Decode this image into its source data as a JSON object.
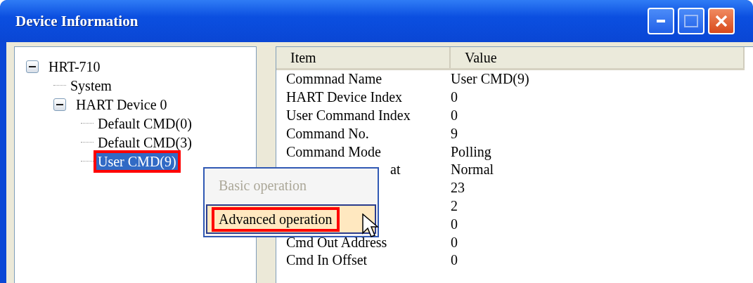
{
  "window": {
    "title": "Device Information"
  },
  "tree": [
    {
      "label": "HRT-710",
      "expanded": true,
      "selected": false,
      "annotated": false,
      "children": [
        {
          "label": "System",
          "selected": false,
          "annotated": false
        },
        {
          "label": "HART Device 0",
          "expanded": true,
          "selected": false,
          "annotated": false,
          "children": [
            {
              "label": "Default CMD(0)",
              "selected": false,
              "annotated": false
            },
            {
              "label": "Default CMD(3)",
              "selected": false,
              "annotated": false
            },
            {
              "label": "User CMD(9)",
              "selected": true,
              "annotated": true
            }
          ]
        }
      ]
    }
  ],
  "list": {
    "columns": [
      "Item",
      "Value"
    ],
    "rows": [
      {
        "item": "Commnad Name",
        "value": "User CMD(9)"
      },
      {
        "item": "HART Device Index",
        "value": "0"
      },
      {
        "item": "User Command Index",
        "value": "0"
      },
      {
        "item": "Command No.",
        "value": "9"
      },
      {
        "item": "Command Mode",
        "value": "Polling"
      },
      {
        "item": "at",
        "partial": true,
        "value": "Normal"
      },
      {
        "value": "23"
      },
      {
        "value": "2"
      },
      {
        "value": "0"
      },
      {
        "item": "Cmd Out Address",
        "value": "0"
      },
      {
        "item": "Cmd In Offset",
        "value": "0"
      }
    ]
  },
  "context_menu": {
    "items": [
      {
        "label": "Basic operation",
        "disabled": true,
        "hovered": false,
        "annotated": false
      },
      {
        "label": "Advanced operation",
        "disabled": false,
        "hovered": true,
        "annotated": true
      }
    ]
  }
}
